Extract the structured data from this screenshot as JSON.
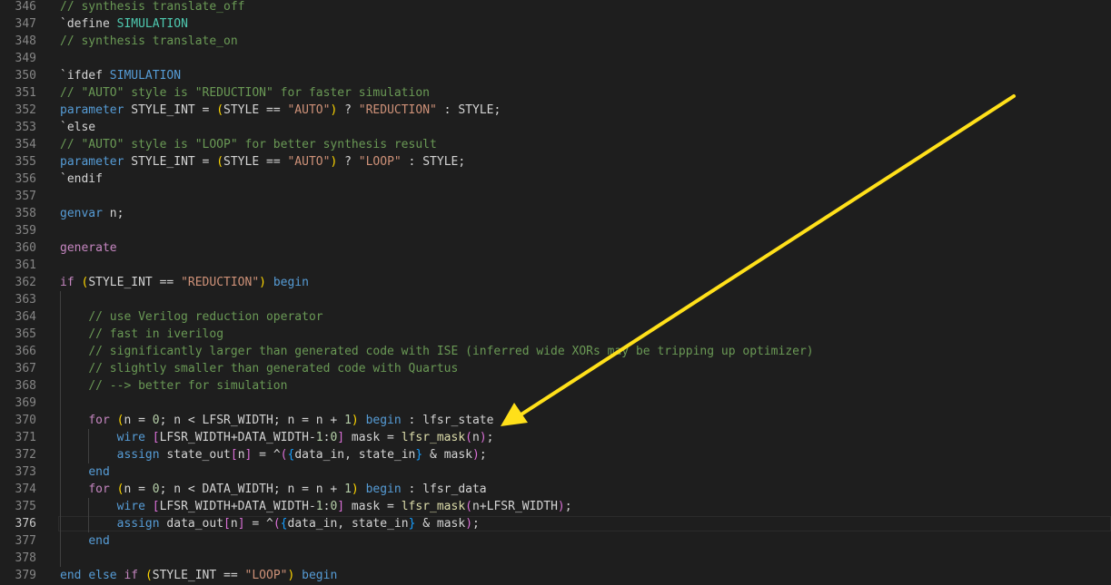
{
  "editor": {
    "active_line": 376,
    "first_line": 346,
    "colors": {
      "background": "#1e1e1e",
      "comment": "#6a9955",
      "keyword": "#569cd6",
      "control": "#c586c0",
      "string": "#ce9178",
      "number": "#b5cea8",
      "function": "#dcdcaa",
      "arrow": "#ffe01a"
    },
    "lines": [
      {
        "n": "346",
        "tokens": [
          [
            "comment",
            "// synthesis translate_off"
          ]
        ]
      },
      {
        "n": "347",
        "tokens": [
          [
            "plain",
            "`define "
          ],
          [
            "macro",
            "SIMULATION"
          ]
        ]
      },
      {
        "n": "348",
        "tokens": [
          [
            "comment",
            "// synthesis translate_on"
          ]
        ]
      },
      {
        "n": "349",
        "tokens": []
      },
      {
        "n": "350",
        "tokens": [
          [
            "plain",
            "`ifdef "
          ],
          [
            "keyword",
            "SIMULATION"
          ]
        ]
      },
      {
        "n": "351",
        "tokens": [
          [
            "comment",
            "// \"AUTO\" style is \"REDUCTION\" for faster simulation"
          ]
        ]
      },
      {
        "n": "352",
        "tokens": [
          [
            "keyword",
            "parameter"
          ],
          [
            "plain",
            " STYLE_INT = "
          ],
          [
            "paren",
            "("
          ],
          [
            "plain",
            "STYLE == "
          ],
          [
            "string",
            "\"AUTO\""
          ],
          [
            "paren",
            ")"
          ],
          [
            "plain",
            " ? "
          ],
          [
            "string",
            "\"REDUCTION\""
          ],
          [
            "plain",
            " : STYLE;"
          ]
        ]
      },
      {
        "n": "353",
        "tokens": [
          [
            "plain",
            "`else"
          ]
        ]
      },
      {
        "n": "354",
        "tokens": [
          [
            "comment",
            "// \"AUTO\" style is \"LOOP\" for better synthesis result"
          ]
        ]
      },
      {
        "n": "355",
        "tokens": [
          [
            "keyword",
            "parameter"
          ],
          [
            "plain",
            " STYLE_INT = "
          ],
          [
            "paren",
            "("
          ],
          [
            "plain",
            "STYLE == "
          ],
          [
            "string",
            "\"AUTO\""
          ],
          [
            "paren",
            ")"
          ],
          [
            "plain",
            " ? "
          ],
          [
            "string",
            "\"LOOP\""
          ],
          [
            "plain",
            " : STYLE;"
          ]
        ]
      },
      {
        "n": "356",
        "tokens": [
          [
            "plain",
            "`endif"
          ]
        ]
      },
      {
        "n": "357",
        "tokens": []
      },
      {
        "n": "358",
        "tokens": [
          [
            "keyword",
            "genvar"
          ],
          [
            "plain",
            " n;"
          ]
        ]
      },
      {
        "n": "359",
        "tokens": []
      },
      {
        "n": "360",
        "tokens": [
          [
            "control",
            "generate"
          ]
        ]
      },
      {
        "n": "361",
        "tokens": []
      },
      {
        "n": "362",
        "tokens": [
          [
            "control",
            "if"
          ],
          [
            "plain",
            " "
          ],
          [
            "paren",
            "("
          ],
          [
            "plain",
            "STYLE_INT == "
          ],
          [
            "string",
            "\"REDUCTION\""
          ],
          [
            "paren",
            ")"
          ],
          [
            "plain",
            " "
          ],
          [
            "keyword",
            "begin"
          ]
        ]
      },
      {
        "n": "363",
        "tokens": []
      },
      {
        "n": "364",
        "tokens": [
          [
            "plain",
            "    "
          ],
          [
            "comment",
            "// use Verilog reduction operator"
          ]
        ]
      },
      {
        "n": "365",
        "tokens": [
          [
            "plain",
            "    "
          ],
          [
            "comment",
            "// fast in iverilog"
          ]
        ]
      },
      {
        "n": "366",
        "tokens": [
          [
            "plain",
            "    "
          ],
          [
            "comment",
            "// significantly larger than generated code with ISE (inferred wide XORs may be tripping up optimizer)"
          ]
        ]
      },
      {
        "n": "367",
        "tokens": [
          [
            "plain",
            "    "
          ],
          [
            "comment",
            "// slightly smaller than generated code with Quartus"
          ]
        ]
      },
      {
        "n": "368",
        "tokens": [
          [
            "plain",
            "    "
          ],
          [
            "comment",
            "// --> better for simulation"
          ]
        ]
      },
      {
        "n": "369",
        "tokens": []
      },
      {
        "n": "370",
        "tokens": [
          [
            "plain",
            "    "
          ],
          [
            "control",
            "for"
          ],
          [
            "plain",
            " "
          ],
          [
            "paren",
            "("
          ],
          [
            "plain",
            "n = "
          ],
          [
            "number",
            "0"
          ],
          [
            "plain",
            "; n < LFSR_WIDTH; n = n + "
          ],
          [
            "number",
            "1"
          ],
          [
            "paren",
            ")"
          ],
          [
            "plain",
            " "
          ],
          [
            "keyword",
            "begin"
          ],
          [
            "plain",
            " : lfsr_state"
          ]
        ]
      },
      {
        "n": "371",
        "tokens": [
          [
            "plain",
            "        "
          ],
          [
            "keyword",
            "wire"
          ],
          [
            "plain",
            " "
          ],
          [
            "paren2",
            "["
          ],
          [
            "plain",
            "LFSR_WIDTH+DATA_WIDTH-"
          ],
          [
            "number",
            "1"
          ],
          [
            "plain",
            ":"
          ],
          [
            "number",
            "0"
          ],
          [
            "paren2",
            "]"
          ],
          [
            "plain",
            " mask = "
          ],
          [
            "func",
            "lfsr_mask"
          ],
          [
            "paren2",
            "("
          ],
          [
            "plain",
            "n"
          ],
          [
            "paren2",
            ")"
          ],
          [
            "plain",
            ";"
          ]
        ]
      },
      {
        "n": "372",
        "tokens": [
          [
            "plain",
            "        "
          ],
          [
            "keyword",
            "assign"
          ],
          [
            "plain",
            " state_out"
          ],
          [
            "paren2",
            "["
          ],
          [
            "plain",
            "n"
          ],
          [
            "paren2",
            "]"
          ],
          [
            "plain",
            " = ^"
          ],
          [
            "paren2",
            "("
          ],
          [
            "paren3",
            "{"
          ],
          [
            "plain",
            "data_in, state_in"
          ],
          [
            "paren3",
            "}"
          ],
          [
            "plain",
            " & mask"
          ],
          [
            "paren2",
            ")"
          ],
          [
            "plain",
            ";"
          ]
        ]
      },
      {
        "n": "373",
        "tokens": [
          [
            "plain",
            "    "
          ],
          [
            "keyword",
            "end"
          ]
        ]
      },
      {
        "n": "374",
        "tokens": [
          [
            "plain",
            "    "
          ],
          [
            "control",
            "for"
          ],
          [
            "plain",
            " "
          ],
          [
            "paren",
            "("
          ],
          [
            "plain",
            "n = "
          ],
          [
            "number",
            "0"
          ],
          [
            "plain",
            "; n < DATA_WIDTH; n = n + "
          ],
          [
            "number",
            "1"
          ],
          [
            "paren",
            ")"
          ],
          [
            "plain",
            " "
          ],
          [
            "keyword",
            "begin"
          ],
          [
            "plain",
            " : lfsr_data"
          ]
        ]
      },
      {
        "n": "375",
        "tokens": [
          [
            "plain",
            "        "
          ],
          [
            "keyword",
            "wire"
          ],
          [
            "plain",
            " "
          ],
          [
            "paren2",
            "["
          ],
          [
            "plain",
            "LFSR_WIDTH+DATA_WIDTH-"
          ],
          [
            "number",
            "1"
          ],
          [
            "plain",
            ":"
          ],
          [
            "number",
            "0"
          ],
          [
            "paren2",
            "]"
          ],
          [
            "plain",
            " mask = "
          ],
          [
            "func",
            "lfsr_mask"
          ],
          [
            "paren2",
            "("
          ],
          [
            "plain",
            "n+LFSR_WIDTH"
          ],
          [
            "paren2",
            ")"
          ],
          [
            "plain",
            ";"
          ]
        ]
      },
      {
        "n": "376",
        "tokens": [
          [
            "plain",
            "        "
          ],
          [
            "keyword",
            "assign"
          ],
          [
            "plain",
            " data_out"
          ],
          [
            "paren2",
            "["
          ],
          [
            "plain",
            "n"
          ],
          [
            "paren2",
            "]"
          ],
          [
            "plain",
            " = ^"
          ],
          [
            "paren2",
            "("
          ],
          [
            "paren3",
            "{"
          ],
          [
            "plain",
            "data_in, state_in"
          ],
          [
            "paren3",
            "}"
          ],
          [
            "plain",
            " & mask"
          ],
          [
            "paren2",
            ")"
          ],
          [
            "plain",
            ";"
          ]
        ]
      },
      {
        "n": "377",
        "tokens": [
          [
            "plain",
            "    "
          ],
          [
            "keyword",
            "end"
          ]
        ]
      },
      {
        "n": "378",
        "tokens": []
      },
      {
        "n": "379",
        "tokens": [
          [
            "keyword",
            "end"
          ],
          [
            "plain",
            " "
          ],
          [
            "keyword",
            "else"
          ],
          [
            "plain",
            " "
          ],
          [
            "control",
            "if"
          ],
          [
            "plain",
            " "
          ],
          [
            "paren",
            "("
          ],
          [
            "plain",
            "STYLE_INT == "
          ],
          [
            "string",
            "\"LOOP\""
          ],
          [
            "paren",
            ")"
          ],
          [
            "plain",
            " "
          ],
          [
            "keyword",
            "begin"
          ]
        ]
      }
    ]
  }
}
